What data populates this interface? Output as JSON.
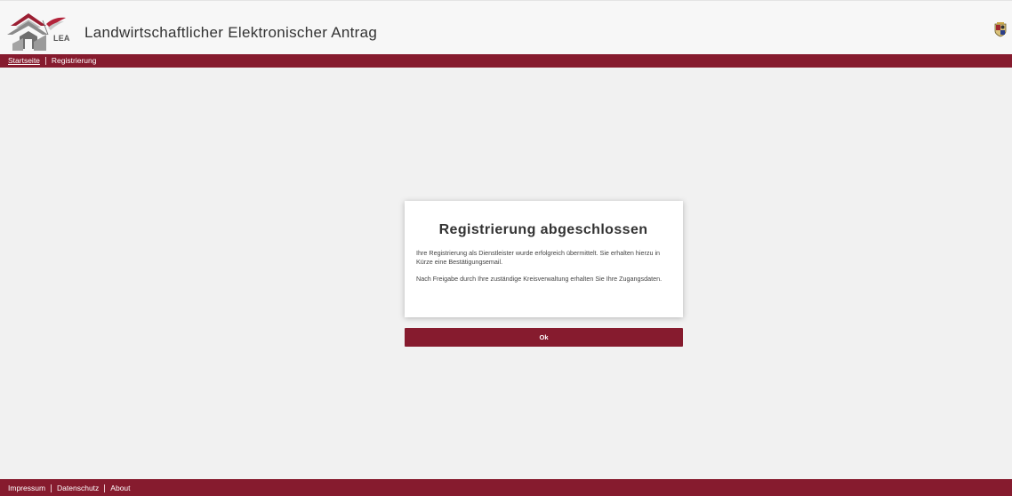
{
  "header": {
    "logo_text": "LEA",
    "title": "Landwirtschaftlicher Elektronischer Antrag",
    "logo_icon": "lea-logo-icon",
    "crest_icon": "state-crest-icon"
  },
  "navbar": {
    "items": [
      {
        "label": "Startseite",
        "link": true
      },
      {
        "label": "Registrierung",
        "link": false
      }
    ]
  },
  "dialog": {
    "title": "Registrierung abgeschlossen",
    "paragraph_1": "Ihre Registrierung als Dienstleister wurde erfolgreich übermittelt. Sie erhalten hierzu in Kürze eine Bestätigungsemail.",
    "paragraph_2": "Nach Freigabe durch Ihre zuständige Kreisverwaltung erhalten Sie Ihre Zugangsdaten."
  },
  "ok_button": {
    "label": "Ok"
  },
  "footer": {
    "items": [
      {
        "label": "Impressum"
      },
      {
        "label": "Datenschutz"
      },
      {
        "label": "About"
      }
    ]
  },
  "colors": {
    "brand": "#861b2e",
    "background": "#f1f1f1"
  }
}
